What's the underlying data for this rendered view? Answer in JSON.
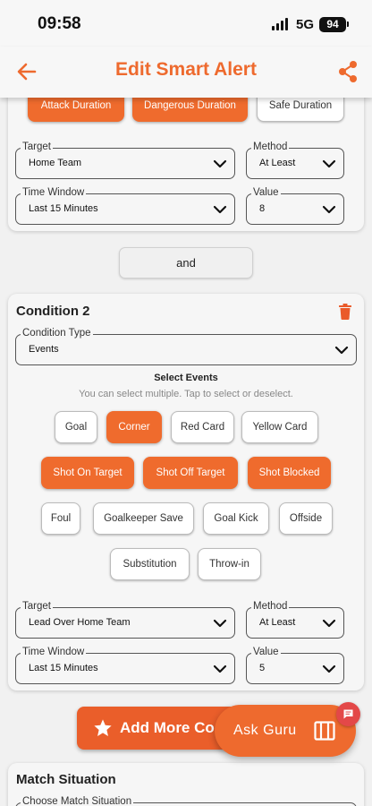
{
  "status_bar": {
    "time": "09:58",
    "network": "5G",
    "battery": "94"
  },
  "header": {
    "title": "Edit Smart Alert"
  },
  "condition1": {
    "duration_chips": [
      {
        "label": "Attack Duration",
        "selected": true
      },
      {
        "label": "Dangerous Duration",
        "selected": true
      },
      {
        "label": "Safe Duration",
        "selected": false
      }
    ],
    "target": {
      "label": "Target",
      "value": "Home Team"
    },
    "method": {
      "label": "Method",
      "value": "At Least"
    },
    "time_window": {
      "label": "Time Window",
      "value": "Last 15 Minutes"
    },
    "value": {
      "label": "Value",
      "value": "8"
    }
  },
  "and_label": "and",
  "condition2": {
    "title": "Condition 2",
    "condition_type": {
      "label": "Condition Type",
      "value": "Events"
    },
    "select_events_title": "Select Events",
    "select_events_hint": "You can select multiple. Tap to select or deselect.",
    "events": [
      {
        "label": "Goal",
        "selected": false
      },
      {
        "label": "Corner",
        "selected": true
      },
      {
        "label": "Red Card",
        "selected": false
      },
      {
        "label": "Yellow Card",
        "selected": false
      },
      {
        "label": "Shot On Target",
        "selected": true
      },
      {
        "label": "Shot Off Target",
        "selected": true
      },
      {
        "label": "Shot Blocked",
        "selected": true
      },
      {
        "label": "Foul",
        "selected": false
      },
      {
        "label": "Goalkeeper Save",
        "selected": false
      },
      {
        "label": "Goal Kick",
        "selected": false
      },
      {
        "label": "Offside",
        "selected": false
      },
      {
        "label": "Substitution",
        "selected": false
      },
      {
        "label": "Throw-in",
        "selected": false
      }
    ],
    "target": {
      "label": "Target",
      "value": "Lead Over Home Team"
    },
    "method": {
      "label": "Method",
      "value": "At Least"
    },
    "time_window": {
      "label": "Time Window",
      "value": "Last 15 Minutes"
    },
    "value": {
      "label": "Value",
      "value": "5"
    }
  },
  "add_more_label": "Add More Co",
  "ask_guru_label": "Ask Guru",
  "match_situation": {
    "title": "Match Situation",
    "field_label": "Choose Match Situation"
  },
  "colors": {
    "accent": "#ee6a2e",
    "selected_chip": "#ef6b2d",
    "badge": "#e34848"
  },
  "icons": [
    "back-arrow-icon",
    "share-icon",
    "chevron-down-icon",
    "trash-icon",
    "star-icon",
    "sidebar-panel-icon",
    "chat-icon",
    "signal-icon"
  ]
}
